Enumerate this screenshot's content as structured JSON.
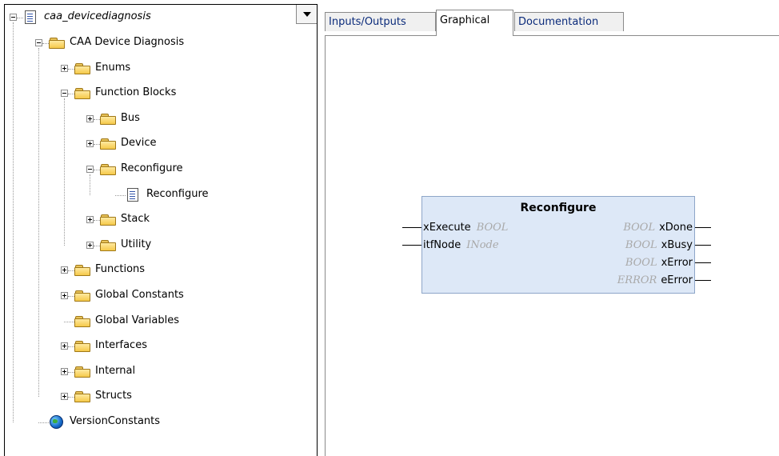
{
  "tree": {
    "root": {
      "label": "caa_devicediagnosis",
      "icon": "document-icon"
    },
    "items": [
      {
        "label": "CAA Device Diagnosis",
        "icon": "folder-icon",
        "expander": "minus"
      },
      {
        "label": "Enums",
        "icon": "folder-icon",
        "expander": "plus"
      },
      {
        "label": "Function Blocks",
        "icon": "folder-icon",
        "expander": "minus"
      },
      {
        "label": "Bus",
        "icon": "folder-icon",
        "expander": "plus"
      },
      {
        "label": "Device",
        "icon": "folder-icon",
        "expander": "plus"
      },
      {
        "label": "Reconfigure",
        "icon": "folder-icon",
        "expander": "minus"
      },
      {
        "label": "Reconfigure",
        "icon": "document-icon",
        "expander": "none"
      },
      {
        "label": "Stack",
        "icon": "folder-icon",
        "expander": "plus"
      },
      {
        "label": "Utility",
        "icon": "folder-icon",
        "expander": "plus"
      },
      {
        "label": "Functions",
        "icon": "folder-icon",
        "expander": "plus"
      },
      {
        "label": "Global Constants",
        "icon": "folder-icon",
        "expander": "plus"
      },
      {
        "label": "Global Variables",
        "icon": "folder-icon",
        "expander": "none"
      },
      {
        "label": "Interfaces",
        "icon": "folder-icon",
        "expander": "plus"
      },
      {
        "label": "Internal",
        "icon": "folder-icon",
        "expander": "plus"
      },
      {
        "label": "Structs",
        "icon": "folder-icon",
        "expander": "plus"
      },
      {
        "label": "VersionConstants",
        "icon": "globe-icon",
        "expander": "none"
      }
    ]
  },
  "tabs": [
    {
      "label": "Inputs/Outputs",
      "active": false
    },
    {
      "label": "Graphical",
      "active": true
    },
    {
      "label": "Documentation",
      "active": false
    }
  ],
  "function_block": {
    "title": "Reconfigure",
    "inputs": [
      {
        "name": "xExecute",
        "type": "BOOL"
      },
      {
        "name": "itfNode",
        "type": "INode"
      }
    ],
    "outputs": [
      {
        "name": "xDone",
        "type": "BOOL"
      },
      {
        "name": "xBusy",
        "type": "BOOL"
      },
      {
        "name": "xError",
        "type": "BOOL"
      },
      {
        "name": "eError",
        "type": "ERROR"
      }
    ]
  },
  "colors": {
    "block_fill": "#dde8f7",
    "block_border": "#8ea6c8",
    "type_text": "#a9a9a9",
    "tab_text": "#0a2a7a"
  }
}
